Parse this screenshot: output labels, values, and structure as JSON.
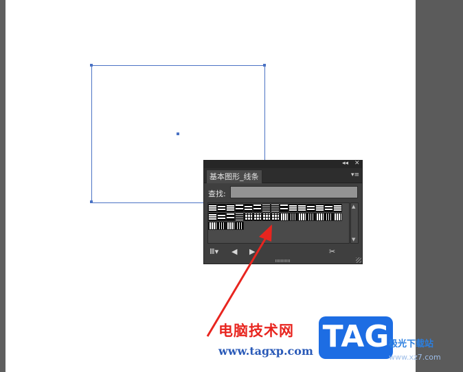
{
  "panel": {
    "title_buttons": {
      "collapse": "◂◂",
      "close": "✕"
    },
    "tab_label": "基本图形_线条",
    "menu_icon": "panel-menu-icon",
    "find_label": "查找:",
    "find_value": "",
    "footer_icons": [
      "library-menu-icon",
      "previous-icon",
      "next-icon",
      "break-link-icon"
    ]
  },
  "watermark": {
    "site_name": "电脑技术网",
    "url": "www.tagxp.com",
    "logo_text": "TAG",
    "right_text": "极光下载站",
    "right_url": "www.xz7.com"
  },
  "colors": {
    "selection": "#4a72c4",
    "arrow": "#e8251f",
    "logo": "#1d6de3"
  }
}
